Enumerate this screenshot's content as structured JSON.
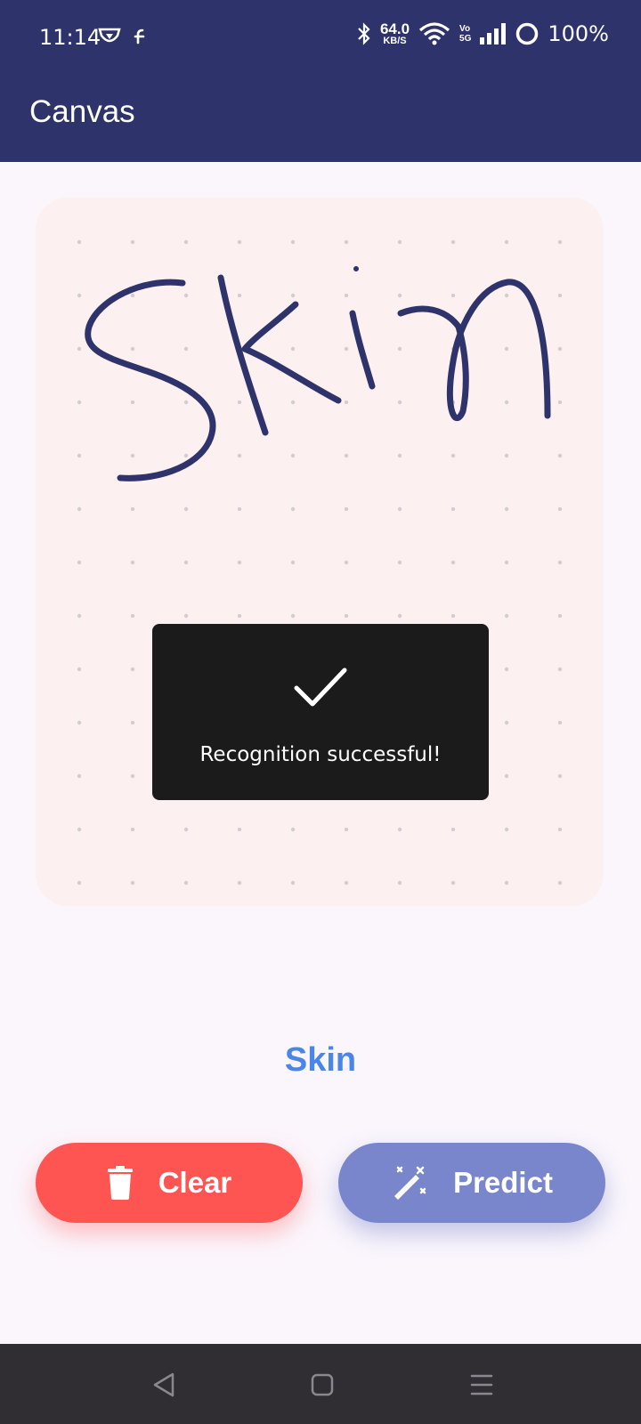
{
  "status_bar": {
    "time": "11:14",
    "net_speed_value": "64.0",
    "net_speed_unit": "KB/S",
    "volte_top": "Vo",
    "volte_bottom": "5G",
    "battery": "100%",
    "icons": [
      "vpn-shield-icon",
      "flash-icon",
      "bluetooth-icon",
      "wifi-icon",
      "signal-icon",
      "battery-ring-icon"
    ]
  },
  "app_bar": {
    "title": "Canvas"
  },
  "canvas": {
    "handwritten_text": "Skin"
  },
  "toast": {
    "icon": "check-icon",
    "message": "Recognition successful!"
  },
  "result": {
    "text": "Skin"
  },
  "buttons": {
    "clear": {
      "label": "Clear",
      "icon": "trash-icon",
      "color": "#fe5452"
    },
    "predict": {
      "label": "Predict",
      "icon": "magic-wand-icon",
      "color": "#7986cb"
    }
  },
  "nav_bar": {
    "icons": [
      "back-icon",
      "home-icon",
      "menu-icon"
    ]
  },
  "colors": {
    "primary": "#2e346b",
    "result": "#4a86e8",
    "canvas_bg": "#fdf0f0",
    "stroke": "#2e346b"
  }
}
